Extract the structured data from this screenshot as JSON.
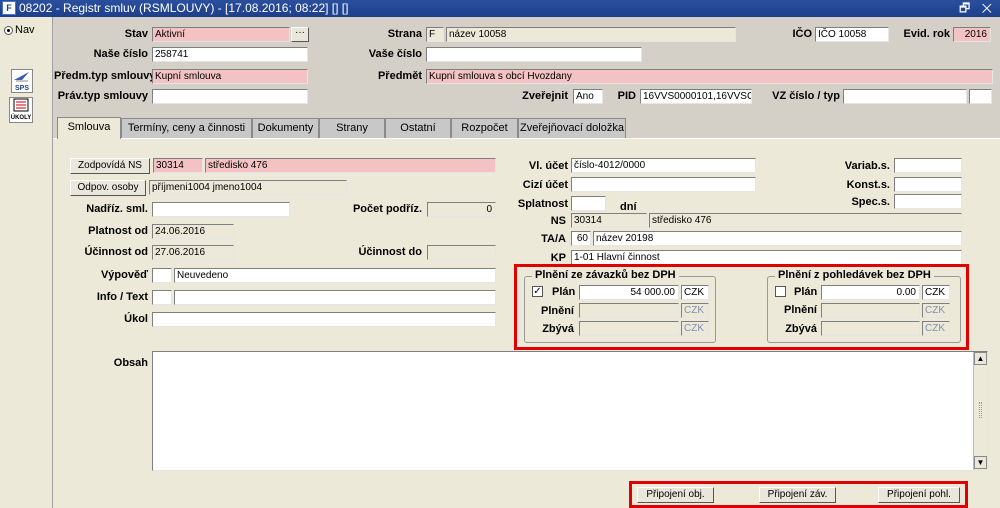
{
  "window": {
    "title": "08202 - Registr smluv (RSMLOUVY) - [17.08.2016; 08:22] [] []",
    "controls": "🗗 ✕",
    "app_icon": "F"
  },
  "left_panel": {
    "nav_label": "Nav",
    "sps_label": "SPS",
    "ukoly_label": "ÚKOLY"
  },
  "header": {
    "stav_label": "Stav",
    "stav_value": "Aktivní",
    "strana_label": "Strana",
    "strana_type": "F",
    "strana_value": "název 10058",
    "ico_label": "IČO",
    "ico_value": "IČO 10058",
    "evid_rok_label": "Evid. rok",
    "evid_rok_value": "2016",
    "nase_cislo_label": "Naše číslo",
    "nase_cislo_value": "258741",
    "vase_cislo_label": "Vaše číslo",
    "vase_cislo_value": "",
    "predm_typ_label": "Předm.typ smlouvy",
    "predm_typ_value": "Kupní smlouva",
    "predmet_label": "Předmět",
    "predmet_value": "Kupní smlouva s obcí Hvozdany",
    "prav_typ_label": "Práv.typ smlouvy",
    "prav_typ_value": "",
    "zverejnit_label": "Zveřejnit",
    "zverejnit_value": "Ano",
    "pid_label": "PID",
    "pid_value": "16VVS0000101,16VVSC",
    "vz_label": "VZ číslo / typ",
    "vz_value": "",
    "vz_type_value": ""
  },
  "tabs": [
    "Smlouva",
    "Termíny, ceny a činnosti",
    "Dokumenty",
    "Strany",
    "Ostatní",
    "Rozpočet",
    "Zveřejňovací doložka"
  ],
  "form": {
    "zodpovida_btn": "Zodpovídá NS",
    "zodpovida_code": "30314",
    "zodpovida_name": "středisko 476",
    "odpov_btn": "Odpov. osoby",
    "odpov_value": "příjmeni1004 jmeno1004",
    "nadriz_label": "Nadříz. sml.",
    "nadriz_value": "",
    "pocet_label": "Počet podříz.",
    "pocet_value": "0",
    "platnost_label": "Platnost od",
    "platnost_value": "24.06.2016",
    "ucinnost_od_label": "Účinnost od",
    "ucinnost_od_value": "27.06.2016",
    "ucinnost_do_label": "Účinnost do",
    "ucinnost_do_value": "",
    "vypoved_label": "Výpověď",
    "vypoved_code": "",
    "vypoved_value": "Neuvedeno",
    "info_label": "Info / Text",
    "info_code": "",
    "info_value": "",
    "ukol_label": "Úkol",
    "ukol_value": "",
    "vl_ucet_label": "Vl. účet",
    "vl_ucet_value": "číslo-4012/0000",
    "cizi_ucet_label": "Cizí účet",
    "cizi_ucet_value": "",
    "splatnost_label": "Splatnost",
    "splatnost_value": "",
    "dni_label": "dní",
    "ns_label": "NS",
    "ns_code": "30314",
    "ns_name": "středisko 476",
    "ta_label": "TA/A",
    "ta_code": "60",
    "ta_name": "název 20198",
    "kp_label": "KP",
    "kp_value": "1-01 Hlavní činnost",
    "varib_label": "Variab.s.",
    "varib_value": "",
    "konst_label": "Konst.s.",
    "konst_value": "",
    "spec_label": "Spec.s.",
    "spec_value": ""
  },
  "plneni_zavazky": {
    "title": "Plnění ze závazků bez DPH",
    "plan_checked": true,
    "plan_label": "Plán",
    "plan_value": "54 000.00",
    "currency": "CZK",
    "plneni_label": "Plnění",
    "plneni_value": "",
    "zbyva_label": "Zbývá",
    "zbyva_value": ""
  },
  "plneni_pohledavky": {
    "title": "Plnění z pohledávek bez DPH",
    "plan_checked": false,
    "plan_label": "Plán",
    "plan_value": "0.00",
    "currency": "CZK",
    "plneni_label": "Plnění",
    "plneni_value": "",
    "zbyva_label": "Zbývá",
    "zbyva_value": ""
  },
  "obsah": {
    "label": "Obsah",
    "value": ""
  },
  "bottom_buttons": {
    "pripojeni_obj": "Připojení obj.",
    "pripojeni_zav": "Připojení záv.",
    "pripojeni_pohl": "Připojení pohl."
  },
  "colors": {
    "titlebar": "#1d3f8c",
    "required_field": "#f4c2c2",
    "highlight": "#e00000",
    "panel": "#ece9d8"
  }
}
